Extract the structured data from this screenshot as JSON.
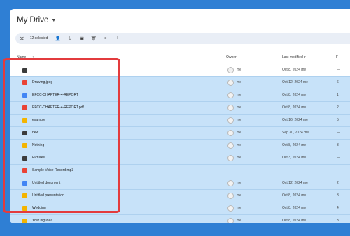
{
  "page": {
    "title": "My Drive"
  },
  "toolbar": {
    "close_icon": "close-icon",
    "selected_count": "12 selected",
    "icons": [
      "share-icon",
      "download-icon",
      "move-icon",
      "trash-icon",
      "link-icon",
      "more-icon"
    ]
  },
  "header": {
    "name": "Name",
    "sort_icon": "↑",
    "owner": "Owner",
    "last_modified": "Last modified ▾",
    "size_col": "F"
  },
  "rows": [
    {
      "name": "",
      "type": "folder",
      "owner": "me",
      "modified": "Oct 8, 2024 me",
      "size": "—",
      "selected": false
    },
    {
      "name": "Drawing.jpeg",
      "type": "image",
      "owner": "me",
      "modified": "Oct 12, 2024 me",
      "size": "6",
      "selected": true
    },
    {
      "name": "EFCC-CHAPTER-4-REPORT",
      "type": "doc",
      "owner": "me",
      "modified": "Oct 8, 2024 me",
      "size": "1",
      "selected": true
    },
    {
      "name": "EFCC-CHAPTER-4-REPORT.pdf",
      "type": "pdf",
      "owner": "me",
      "modified": "Oct 8, 2024 me",
      "size": "2",
      "selected": true
    },
    {
      "name": "example",
      "type": "slides",
      "owner": "me",
      "modified": "Oct 16, 2024 me",
      "size": "5",
      "selected": true
    },
    {
      "name": "new",
      "type": "folder",
      "owner": "me",
      "modified": "Sep 30, 2024 me",
      "size": "—",
      "selected": true
    },
    {
      "name": "Nothing",
      "type": "slides",
      "owner": "me",
      "modified": "Oct 8, 2024 me",
      "size": "3",
      "selected": true
    },
    {
      "name": "Pictures",
      "type": "folder",
      "owner": "me",
      "modified": "Oct 3, 2024 me",
      "size": "—",
      "selected": true
    },
    {
      "name": "Sample Voice Record.mp3",
      "type": "audio",
      "owner": "",
      "modified": "",
      "size": "",
      "selected": true
    },
    {
      "name": "Untitled document",
      "type": "doc",
      "owner": "me",
      "modified": "Oct 12, 2024 me",
      "size": "2",
      "selected": true
    },
    {
      "name": "Untitled presentation",
      "type": "slides",
      "owner": "me",
      "modified": "Oct 8, 2024 me",
      "size": "3",
      "selected": true
    },
    {
      "name": "Wedding",
      "type": "slides",
      "owner": "me",
      "modified": "Oct 8, 2024 me",
      "size": "4",
      "selected": true
    },
    {
      "name": "Your big idea",
      "type": "slides",
      "owner": "me",
      "modified": "Oct 8, 2024 me",
      "size": "3",
      "selected": true
    }
  ],
  "colors": {
    "background": "#2f7fd4",
    "selection": "#c7e2f9",
    "highlight_border": "#e33b3d",
    "folder": "#3c3c3c",
    "doc": "#4285f4",
    "pdf": "#ea4335",
    "slides": "#f4b400",
    "image": "#ea4335",
    "audio": "#ea4335"
  }
}
